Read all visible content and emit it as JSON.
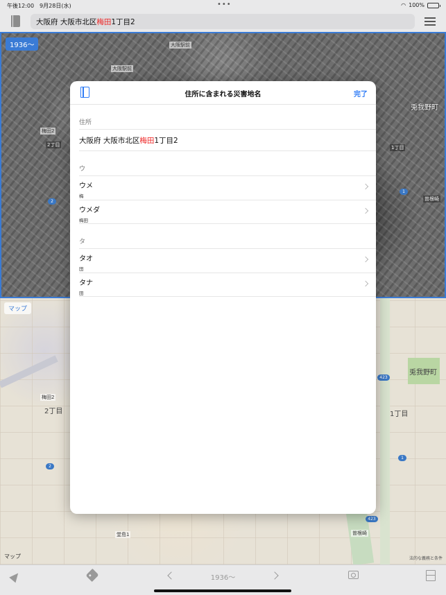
{
  "status_bar": {
    "time_date": "午後12:00　9月28日(水)",
    "battery": "100%",
    "battery_level": 1.0
  },
  "top_bar": {
    "address_prefix": "大阪府 大阪市北区 ",
    "address_highlight": "梅田",
    "address_suffix": "1丁目2"
  },
  "old_map": {
    "era_badge": "1936～",
    "labels": {
      "osaka_station": "大阪駅前",
      "osaka_station_front": "大阪駅前",
      "umeda2": "梅田2",
      "chome2": "2丁目",
      "kitano": "兎我野町",
      "chome1": "1丁目",
      "sonezaki": "曽根崎"
    },
    "routes": {
      "r2": "2",
      "r1": "1"
    }
  },
  "current_map": {
    "badge": "マップ",
    "labels": {
      "umeda2": "梅田2",
      "chome2": "2丁目",
      "kitano": "兎我野町",
      "chome1": "1丁目",
      "sonezaki": "曽根崎",
      "dojima": "堂島1"
    },
    "routes": {
      "r423a": "423",
      "r423b": "423",
      "r2": "2",
      "r1": "1"
    },
    "attribution": "マップ",
    "legal": "法的な義務と条件"
  },
  "modal": {
    "title": "住所に含まれる災害地名",
    "done": "完了",
    "address_section": "住所",
    "address_prefix": "大阪府 大阪市北区 ",
    "address_highlight": "梅田",
    "address_suffix": "1丁目2",
    "groups": [
      {
        "header": "ウ",
        "items": [
          {
            "title": "ウメ",
            "sub": "梅"
          },
          {
            "title": "ウメダ",
            "sub": "梅田"
          }
        ]
      },
      {
        "header": "タ",
        "items": [
          {
            "title": "タオ",
            "sub": "田"
          },
          {
            "title": "タナ",
            "sub": "田"
          }
        ]
      }
    ]
  },
  "toolbar": {
    "era": "1936～"
  }
}
